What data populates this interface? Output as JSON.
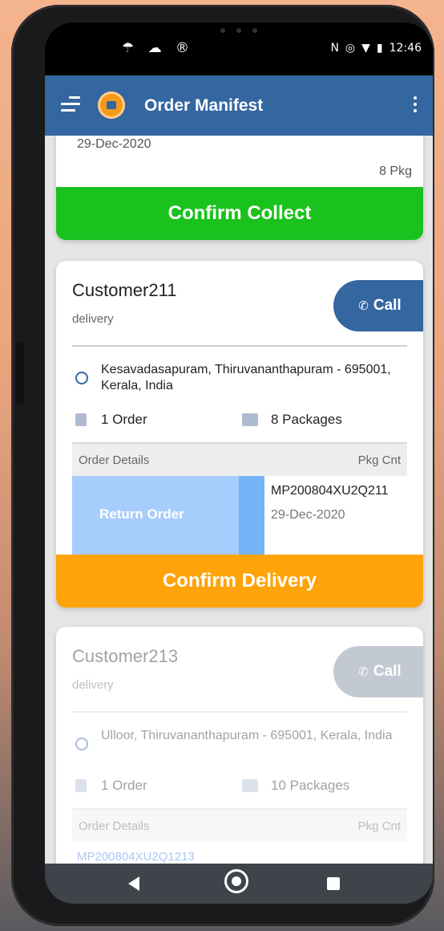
{
  "status_bar": {
    "left_icons": "☂ ☁ ®",
    "right_icons": [
      "N",
      "◎",
      "▼",
      "▮"
    ],
    "time": "12:46"
  },
  "appbar": {
    "title": "Order Manifest"
  },
  "card_top": {
    "date": "29-Dec-2020",
    "packages": "8 Pkg",
    "button_label": "Confirm Collect"
  },
  "card_main": {
    "customer": "Customer211",
    "type": "delivery",
    "call_label": "Call",
    "address": "Kesavadasapuram, Thiruvananthapuram - 695001, Kerala, India",
    "orders": "1 Order",
    "packages": "8 Packages",
    "table_header_left": "Order Details",
    "table_header_right": "Pkg Cnt",
    "return_label": "Return Order",
    "order_id": "MP200804XU2Q211",
    "order_date": "29-Dec-2020",
    "button_label": "Confirm Delivery"
  },
  "card_next": {
    "customer": "Customer213",
    "type": "delivery",
    "call_label": "Call",
    "address": "Ulloor, Thiruvananthapuram - 695001, Kerala, India",
    "orders": "1 Order",
    "packages": "10 Packages",
    "table_header_left": "Order Details",
    "table_header_right": "Pkg Cnt",
    "order_id": "MP200804XU2Q1213"
  },
  "colors": {
    "appbar": "#3466a0",
    "collect_green": "#1ac21d",
    "delivery_orange": "#ffa30a",
    "return_blue": "#a6cdfb"
  }
}
